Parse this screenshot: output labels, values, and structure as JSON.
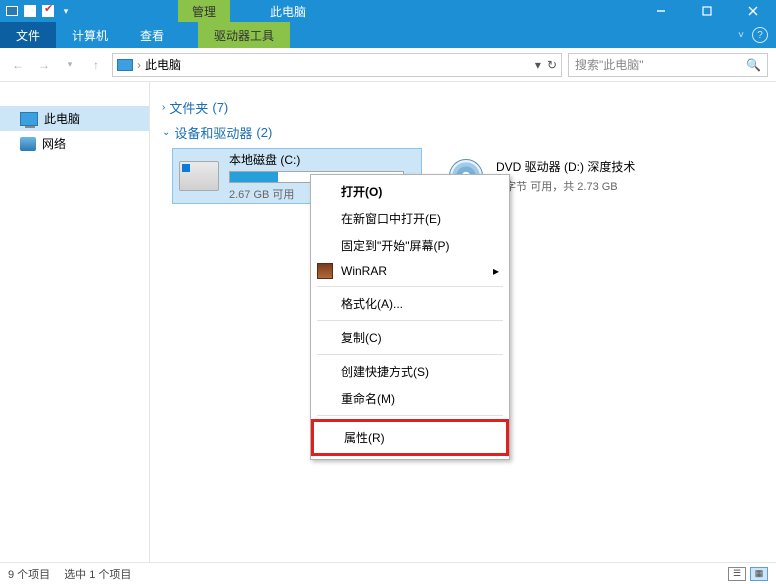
{
  "titlebar": {
    "manage_tab": "管理",
    "window_title": "此电脑"
  },
  "ribbon": {
    "file": "文件",
    "computer": "计算机",
    "view": "查看",
    "drive_tools": "驱动器工具"
  },
  "nav": {
    "location": "此电脑",
    "search_placeholder": "搜索\"此电脑\""
  },
  "sidebar": {
    "this_pc": "此电脑",
    "network": "网络"
  },
  "groups": {
    "folders": {
      "label": "文件夹",
      "count": "(7)"
    },
    "devices": {
      "label": "设备和驱动器",
      "count": "(2)"
    }
  },
  "drives": {
    "c": {
      "name": "本地磁盘 (C:)",
      "sub": "2.67 GB 可用",
      "fill_pct": 28
    },
    "d": {
      "name": "DVD 驱动器 (D:) 深度技术",
      "sub": "0 字节 可用，共 2.73 GB"
    }
  },
  "ctx": {
    "open": "打开(O)",
    "open_new_window": "在新窗口中打开(E)",
    "pin_start": "固定到\"开始\"屏幕(P)",
    "winrar": "WinRAR",
    "format": "格式化(A)...",
    "copy": "复制(C)",
    "create_shortcut": "创建快捷方式(S)",
    "rename": "重命名(M)",
    "properties": "属性(R)"
  },
  "status": {
    "items": "9 个项目",
    "selected": "选中 1 个项目"
  }
}
